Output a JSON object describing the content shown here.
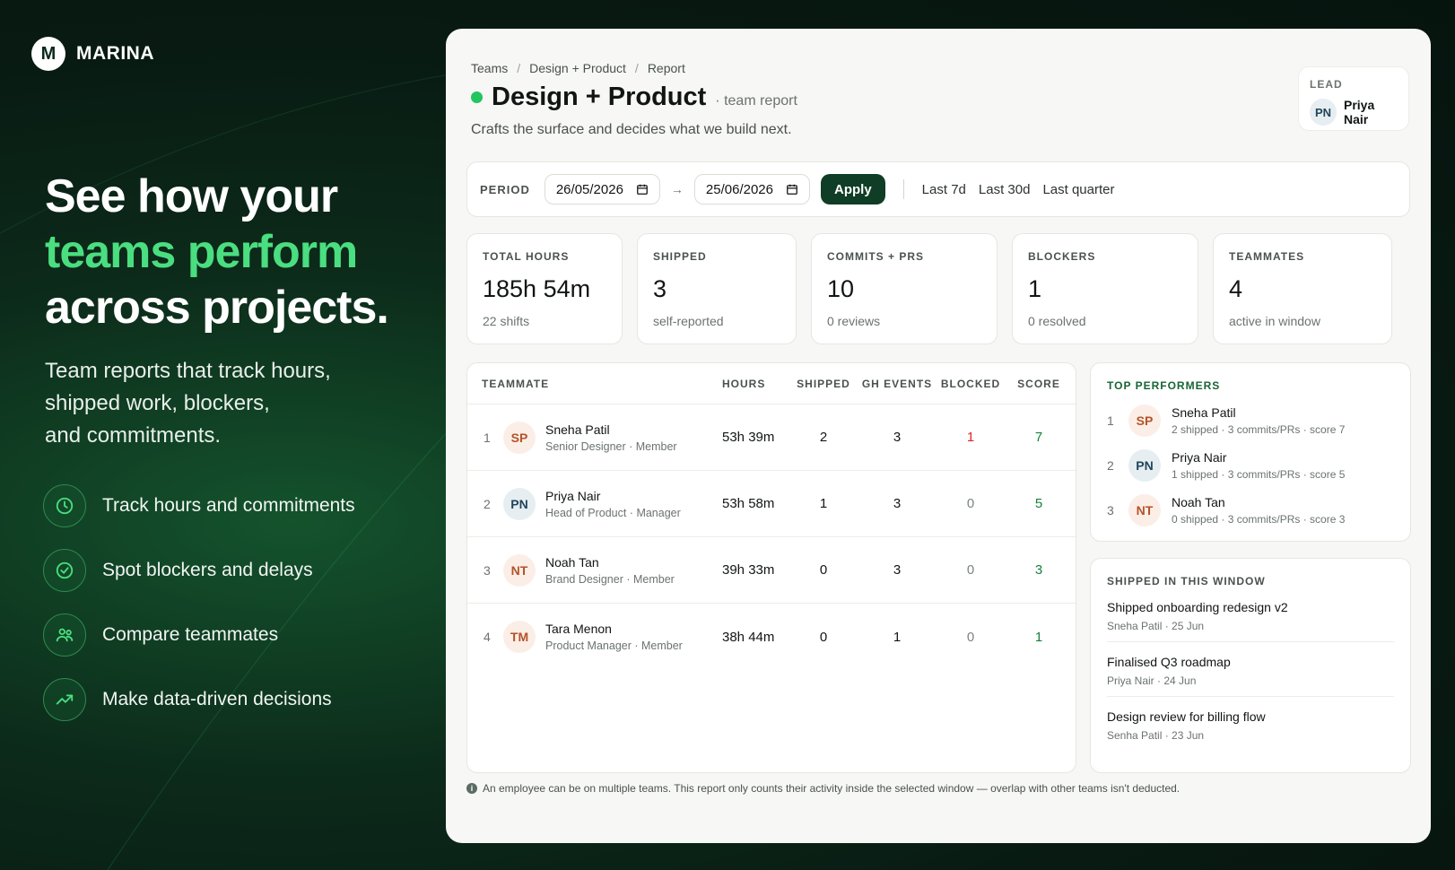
{
  "brand": {
    "logo_letter": "M",
    "name": "MARINA"
  },
  "hero": {
    "line1": "See how your",
    "line2": "teams perform",
    "line3": "across projects.",
    "subtitle_lines": [
      "Team reports that track hours,",
      "shipped work, blockers,",
      "and commitments."
    ]
  },
  "features": [
    {
      "icon": "clock-icon",
      "label": "Track hours and commitments"
    },
    {
      "icon": "check-circle-icon",
      "label": "Spot blockers and delays"
    },
    {
      "icon": "users-icon",
      "label": "Compare teammates"
    },
    {
      "icon": "trend-up-icon",
      "label": "Make data-driven decisions"
    }
  ],
  "report": {
    "breadcrumb": [
      "Teams",
      "Design + Product",
      "Report"
    ],
    "breadcrumb_sep": "/",
    "title": "Design + Product",
    "title_tag": "· team report",
    "description": "Crafts the surface and decides what we build next.",
    "status_color": "#22c55e",
    "lead": {
      "label": "LEAD",
      "initials": "PN",
      "name": "Priya Nair"
    },
    "period": {
      "label": "PERIOD",
      "from": "26/05/2026",
      "to": "25/06/2026",
      "arrow": "→",
      "apply_label": "Apply",
      "quick_ranges": [
        "Last 7d",
        "Last 30d",
        "Last quarter"
      ]
    },
    "stats": [
      {
        "label": "TOTAL HOURS",
        "value": "185h 54m",
        "sub": "22 shifts"
      },
      {
        "label": "SHIPPED",
        "value": "3",
        "sub": "self-reported"
      },
      {
        "label": "COMMITS + PRS",
        "value": "10",
        "sub": "0 reviews"
      },
      {
        "label": "BLOCKERS",
        "value": "1",
        "sub": "0 resolved"
      },
      {
        "label": "TEAMMATES",
        "value": "4",
        "sub": "active in window"
      }
    ],
    "table": {
      "headers": {
        "teammate": "TEAMMATE",
        "hours": "HOURS",
        "shipped": "SHIPPED",
        "gh_events": "GH EVENTS",
        "blocked": "BLOCKED",
        "score": "SCORE"
      },
      "rows": [
        {
          "rank": "1",
          "initials": "SP",
          "name": "Sneha Patil",
          "role": "Senior Designer · Member",
          "hours": "53h 39m",
          "shipped": "2",
          "gh_events": "3",
          "blocked": "1",
          "score": "7"
        },
        {
          "rank": "2",
          "initials": "PN",
          "name": "Priya Nair",
          "role": "Head of Product · Manager",
          "hours": "53h 58m",
          "shipped": "1",
          "gh_events": "3",
          "blocked": "0",
          "score": "5"
        },
        {
          "rank": "3",
          "initials": "NT",
          "name": "Noah Tan",
          "role": "Brand Designer · Member",
          "hours": "39h 33m",
          "shipped": "0",
          "gh_events": "3",
          "blocked": "0",
          "score": "3"
        },
        {
          "rank": "4",
          "initials": "TM",
          "name": "Tara Menon",
          "role": "Product Manager · Member",
          "hours": "38h 44m",
          "shipped": "0",
          "gh_events": "1",
          "blocked": "0",
          "score": "1"
        }
      ]
    },
    "top_performers": {
      "title": "TOP PERFORMERS",
      "items": [
        {
          "rank": "1",
          "initials": "SP",
          "name": "Sneha Patil",
          "meta": "2 shipped · 3 commits/PRs · score 7"
        },
        {
          "rank": "2",
          "initials": "PN",
          "name": "Priya Nair",
          "meta": "1 shipped · 3 commits/PRs · score 5"
        },
        {
          "rank": "3",
          "initials": "NT",
          "name": "Noah Tan",
          "meta": "0 shipped · 3 commits/PRs · score 3"
        }
      ]
    },
    "shipped": {
      "title": "SHIPPED IN THIS WINDOW",
      "items": [
        {
          "title": "Shipped onboarding redesign v2",
          "meta": "Sneha Patil · 25 Jun"
        },
        {
          "title": "Finalised Q3 roadmap",
          "meta": "Priya Nair · 24 Jun"
        },
        {
          "title": "Design review for billing flow",
          "meta": "Senha Patil · 23 Jun"
        }
      ]
    },
    "footnote": "An employee can be on multiple teams. This report only counts their activity inside the selected window — overlap with other teams isn't deducted."
  },
  "colors": {
    "accent_green": "#4ade80",
    "brand_dark": "#0f3d25",
    "blocker_red": "#dc2626",
    "score_green": "#16803a"
  }
}
